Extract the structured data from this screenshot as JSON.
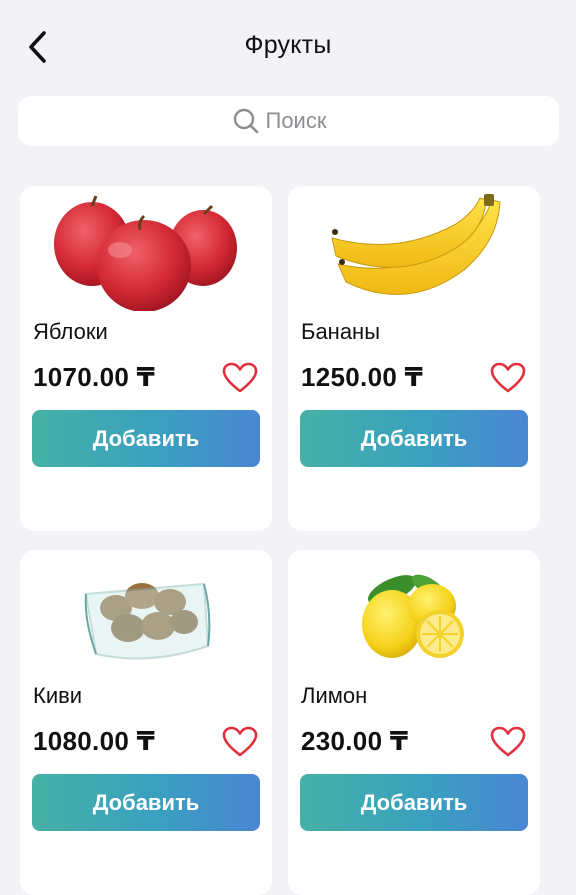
{
  "header": {
    "title": "Фрукты",
    "back_icon": "chevron-left-icon"
  },
  "search": {
    "placeholder": "Поиск",
    "icon": "search-icon"
  },
  "products": [
    {
      "name": "Яблоки",
      "price": "1070.00 ₸",
      "add_label": "Добавить",
      "image": "apples-image"
    },
    {
      "name": "Бананы",
      "price": "1250.00 ₸",
      "add_label": "Добавить",
      "image": "bananas-image"
    },
    {
      "name": "Киви",
      "price": "1080.00 ₸",
      "add_label": "Добавить",
      "image": "kiwi-image"
    },
    {
      "name": "Лимон",
      "price": "230.00 ₸",
      "add_label": "Добавить",
      "image": "lemon-image"
    }
  ],
  "colors": {
    "background": "#f2f2f7",
    "card": "#ffffff",
    "button_gradient_start": "#45b1a5",
    "button_gradient_end": "#4a86d3",
    "heart": "#e0303e"
  }
}
